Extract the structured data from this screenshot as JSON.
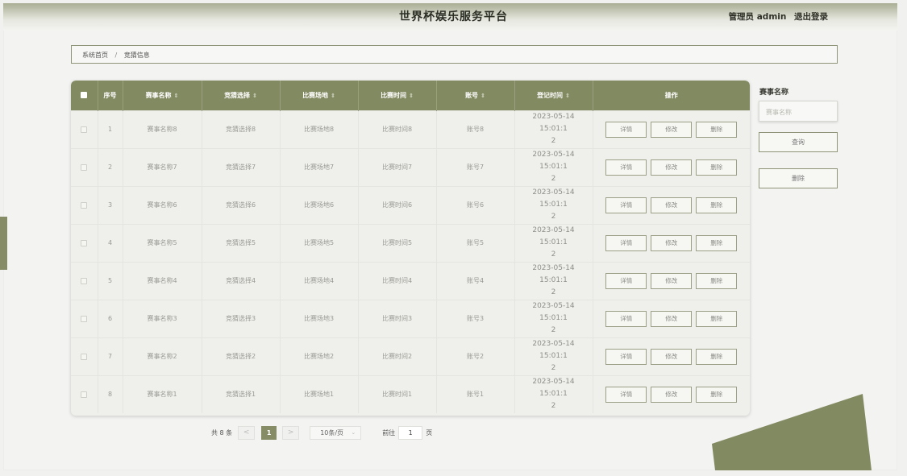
{
  "header": {
    "title": "世界杯娱乐服务平台",
    "user_label": "管理员 admin",
    "logout_label": "退出登录"
  },
  "breadcrumb": {
    "home": "系统首页",
    "separator": "/",
    "current": "竞猜信息"
  },
  "table": {
    "columns": [
      "序号",
      "赛事名称",
      "竞猜选择",
      "比赛场地",
      "比赛时间",
      "账号",
      "登记时间",
      "操作"
    ],
    "sort_icon": "⇕",
    "rows": [
      {
        "index": "1",
        "name": "赛事名称8",
        "choice": "竞猜选择8",
        "venue": "比赛场地8",
        "match_time": "比赛时间8",
        "account": "账号8",
        "reg_time_1": "2023-05-14 15:01:1",
        "reg_time_2": "2"
      },
      {
        "index": "2",
        "name": "赛事名称7",
        "choice": "竞猜选择7",
        "venue": "比赛场地7",
        "match_time": "比赛时间7",
        "account": "账号7",
        "reg_time_1": "2023-05-14 15:01:1",
        "reg_time_2": "2"
      },
      {
        "index": "3",
        "name": "赛事名称6",
        "choice": "竞猜选择6",
        "venue": "比赛场地6",
        "match_time": "比赛时间6",
        "account": "账号6",
        "reg_time_1": "2023-05-14 15:01:1",
        "reg_time_2": "2"
      },
      {
        "index": "4",
        "name": "赛事名称5",
        "choice": "竞猜选择5",
        "venue": "比赛场地5",
        "match_time": "比赛时间5",
        "account": "账号5",
        "reg_time_1": "2023-05-14 15:01:1",
        "reg_time_2": "2"
      },
      {
        "index": "5",
        "name": "赛事名称4",
        "choice": "竞猜选择4",
        "venue": "比赛场地4",
        "match_time": "比赛时间4",
        "account": "账号4",
        "reg_time_1": "2023-05-14 15:01:1",
        "reg_time_2": "2"
      },
      {
        "index": "6",
        "name": "赛事名称3",
        "choice": "竞猜选择3",
        "venue": "比赛场地3",
        "match_time": "比赛时间3",
        "account": "账号3",
        "reg_time_1": "2023-05-14 15:01:1",
        "reg_time_2": "2"
      },
      {
        "index": "7",
        "name": "赛事名称2",
        "choice": "竞猜选择2",
        "venue": "比赛场地2",
        "match_time": "比赛时间2",
        "account": "账号2",
        "reg_time_1": "2023-05-14 15:01:1",
        "reg_time_2": "2"
      },
      {
        "index": "8",
        "name": "赛事名称1",
        "choice": "竞猜选择1",
        "venue": "比赛场地1",
        "match_time": "比赛时间1",
        "account": "账号1",
        "reg_time_1": "2023-05-14 15:01:1",
        "reg_time_2": "2"
      }
    ],
    "actions": {
      "detail": "详情",
      "edit": "修改",
      "delete": "删除"
    }
  },
  "search": {
    "label": "赛事名称",
    "placeholder": "赛事名称",
    "query_button": "查询",
    "delete_button": "删除"
  },
  "pagination": {
    "total": "共 8 条",
    "prev": "<",
    "current_page": "1",
    "next": ">",
    "page_size": "10条/页",
    "goto_label": "前往",
    "goto_value": "1",
    "page_suffix": "页"
  },
  "colors": {
    "accent": "#828a61",
    "header_text": "#ffffff",
    "background": "#f1f1ef"
  }
}
